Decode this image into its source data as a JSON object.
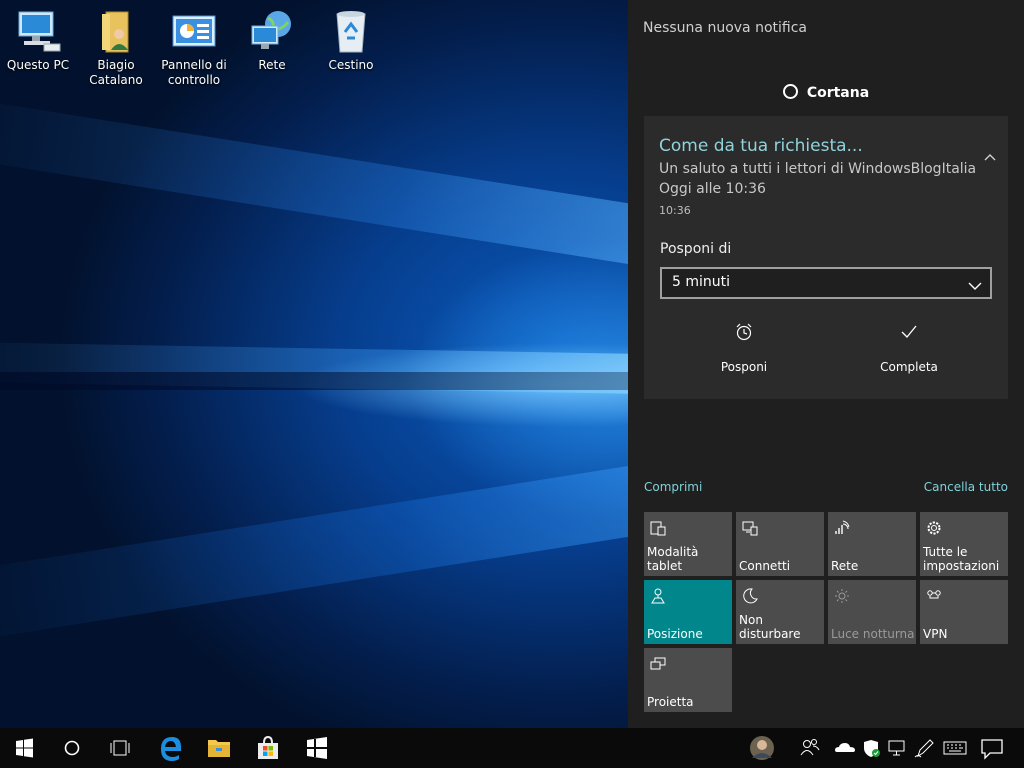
{
  "desktop": {
    "icons": [
      {
        "label": "Questo PC",
        "icon": "computer-icon"
      },
      {
        "label": "Biagio\nCatalano",
        "icon": "user-folder-icon"
      },
      {
        "label": "Pannello di\ncontrollo",
        "icon": "control-panel-icon"
      },
      {
        "label": "Rete",
        "icon": "network-icon"
      },
      {
        "label": "Cestino",
        "icon": "recycle-bin-icon"
      }
    ]
  },
  "action_center": {
    "no_notifications": "Nessuna nuova notifica",
    "app_name": "Cortana",
    "toast": {
      "title": "Come da tua richiesta...",
      "body": "Un saluto a tutti i lettori di WindowsBlogItalia",
      "subtext": "Oggi alle 10:36",
      "time": "10:36",
      "snooze_label": "Posponi di",
      "snooze_value": "5 minuti",
      "snooze_button": "Posponi",
      "complete_button": "Completa"
    },
    "collapse_link": "Comprimi",
    "clear_all_link": "Cancella tutto",
    "quick_actions": [
      {
        "label": "Modalità tablet",
        "icon": "tablet-mode-icon",
        "state": "off"
      },
      {
        "label": "Connetti",
        "icon": "connect-icon",
        "state": "off"
      },
      {
        "label": "Rete",
        "icon": "network-icon",
        "state": "off"
      },
      {
        "label": "Tutte le impostazioni",
        "icon": "settings-icon",
        "state": "off"
      },
      {
        "label": "Posizione",
        "icon": "location-icon",
        "state": "on"
      },
      {
        "label": "Non disturbare",
        "icon": "moon-icon",
        "state": "off"
      },
      {
        "label": "Luce notturna",
        "icon": "night-light-icon",
        "state": "disabled"
      },
      {
        "label": "VPN",
        "icon": "vpn-icon",
        "state": "off"
      },
      {
        "label": "Proietta",
        "icon": "project-icon",
        "state": "off"
      }
    ]
  },
  "taskbar": {
    "items": [
      "start-icon",
      "cortana-search-icon",
      "task-view-icon",
      "edge-icon",
      "file-explorer-icon",
      "store-icon",
      "app-icon"
    ],
    "tray": [
      "user-avatar",
      "people-icon",
      "onedrive-icon",
      "defender-icon",
      "network-icon",
      "pen-icon",
      "keyboard-icon",
      "action-center-icon"
    ]
  },
  "colors": {
    "accent": "#00868b",
    "toast_title": "#8fd3dc",
    "link": "#7fd1da",
    "panel_bg": "#1f1f1f",
    "toast_bg": "#2b2b2b",
    "tile_bg": "#4c4c4c"
  }
}
